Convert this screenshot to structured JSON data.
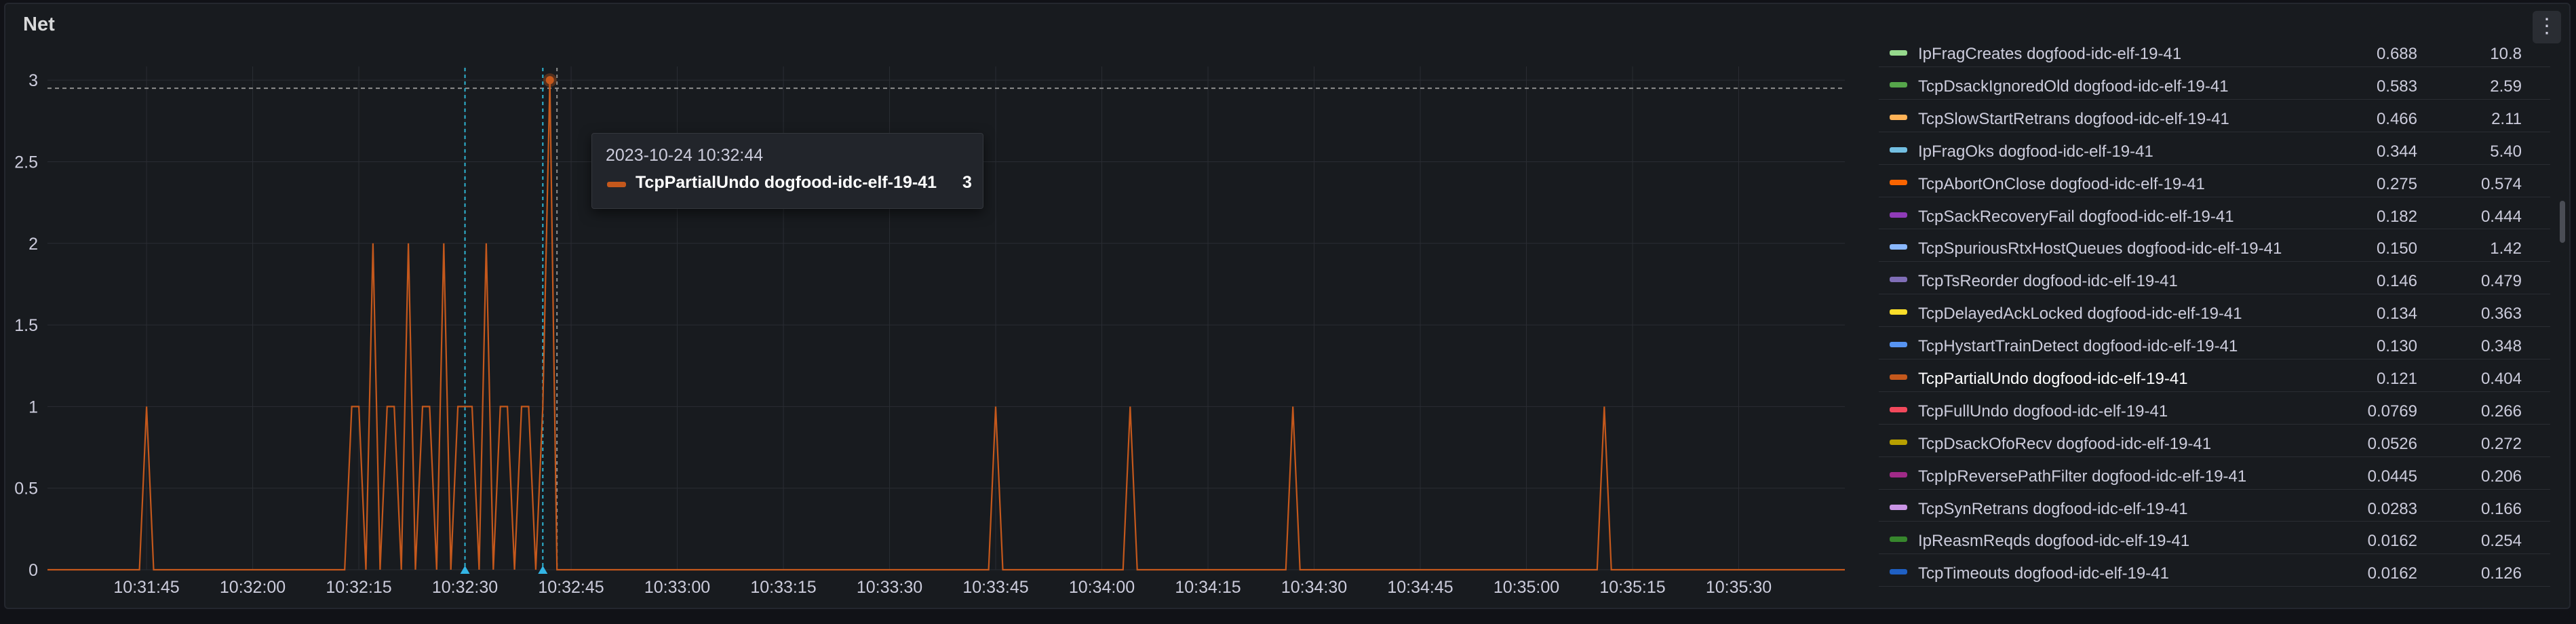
{
  "panel": {
    "title": "Net",
    "menu_icon": "kebab-menu-icon"
  },
  "tooltip": {
    "time": "2023-10-24 10:32:44",
    "series": "TcpPartialUndo dogfood-idc-elf-19-41",
    "value": "3",
    "color": "#c4581c"
  },
  "chart_data": {
    "type": "line",
    "title": "Net",
    "x_ticks": [
      "10:31:45",
      "10:32:00",
      "10:32:15",
      "10:32:30",
      "10:32:45",
      "10:33:00",
      "10:33:15",
      "10:33:30",
      "10:33:45",
      "10:34:00",
      "10:34:15",
      "10:34:30",
      "10:34:45",
      "10:35:00",
      "10:35:15",
      "10:35:30"
    ],
    "y_ticks": [
      "0",
      "0.5",
      "1",
      "1.5",
      "2",
      "2.5",
      "3"
    ],
    "ylim": [
      0,
      3.2
    ],
    "xlim": [
      "10:31:31",
      "10:35:45"
    ],
    "grid": true,
    "threshold_line": 2.95,
    "markers": [
      "10:32:30",
      "10:32:41",
      "10:32:43"
    ],
    "series": [
      {
        "name": "TcpPartialUndo dogfood-idc-elf-19-41",
        "color": "#c4581c",
        "x": [
          "10:31:31",
          "10:31:44",
          "10:31:45",
          "10:31:46",
          "10:32:13",
          "10:32:14",
          "10:32:15",
          "10:32:16",
          "10:32:17",
          "10:32:18",
          "10:32:19",
          "10:32:20",
          "10:32:21",
          "10:32:22",
          "10:32:23",
          "10:32:24",
          "10:32:25",
          "10:32:26",
          "10:32:27",
          "10:32:28",
          "10:32:29",
          "10:32:30",
          "10:32:31",
          "10:32:32",
          "10:32:33",
          "10:32:34",
          "10:32:35",
          "10:32:36",
          "10:32:37",
          "10:32:38",
          "10:32:39",
          "10:32:40",
          "10:32:41",
          "10:32:42",
          "10:32:43",
          "10:32:44",
          "10:32:45",
          "10:32:46",
          "10:33:44",
          "10:33:45",
          "10:33:46",
          "10:34:03",
          "10:34:04",
          "10:34:05",
          "10:34:26",
          "10:34:27",
          "10:34:28",
          "10:35:10",
          "10:35:11",
          "10:35:12",
          "10:35:45"
        ],
        "y": [
          0,
          0,
          1,
          0,
          0,
          1,
          1,
          0,
          2,
          0,
          1,
          1,
          0,
          2,
          0,
          1,
          1,
          0,
          2,
          0,
          1,
          1,
          1,
          0,
          2,
          0,
          1,
          1,
          0,
          1,
          1,
          0,
          1,
          3,
          0,
          0,
          0,
          0,
          0,
          1,
          0,
          0,
          1,
          0,
          0,
          1,
          0,
          0,
          1,
          0,
          0
        ]
      }
    ]
  },
  "legend": [
    {
      "name": "IpFragCreates dogfood-idc-elf-19-41",
      "mean": "0.688",
      "max": "10.8",
      "color": "#96d98d"
    },
    {
      "name": "TcpDsackIgnoredOld dogfood-idc-elf-19-41",
      "mean": "0.583",
      "max": "2.59",
      "color": "#56a64b"
    },
    {
      "name": "TcpSlowStartRetrans dogfood-idc-elf-19-41",
      "mean": "0.466",
      "max": "2.11",
      "color": "#ffb357"
    },
    {
      "name": "IpFragOks dogfood-idc-elf-19-41",
      "mean": "0.344",
      "max": "5.40",
      "color": "#73bfe2"
    },
    {
      "name": "TcpAbortOnClose dogfood-idc-elf-19-41",
      "mean": "0.275",
      "max": "0.574",
      "color": "#fa6400"
    },
    {
      "name": "TcpSackRecoveryFail dogfood-idc-elf-19-41",
      "mean": "0.182",
      "max": "0.444",
      "color": "#8f3bb8"
    },
    {
      "name": "TcpSpuriousRtxHostQueues dogfood-idc-elf-19-41",
      "mean": "0.150",
      "max": "1.42",
      "color": "#8ab8ff"
    },
    {
      "name": "TcpTsReorder dogfood-idc-elf-19-41",
      "mean": "0.146",
      "max": "0.479",
      "color": "#806eb7"
    },
    {
      "name": "TcpDelayedAckLocked dogfood-idc-elf-19-41",
      "mean": "0.134",
      "max": "0.363",
      "color": "#fade2a"
    },
    {
      "name": "TcpHystartTrainDetect dogfood-idc-elf-19-41",
      "mean": "0.130",
      "max": "0.348",
      "color": "#5794f2"
    },
    {
      "name": "TcpPartialUndo dogfood-idc-elf-19-41",
      "mean": "0.121",
      "max": "0.404",
      "color": "#c4581c",
      "active": true
    },
    {
      "name": "TcpFullUndo dogfood-idc-elf-19-41",
      "mean": "0.0769",
      "max": "0.266",
      "color": "#f2495c"
    },
    {
      "name": "TcpDsackOfoRecv dogfood-idc-elf-19-41",
      "mean": "0.0526",
      "max": "0.272",
      "color": "#b8a000"
    },
    {
      "name": "TcpIpReversePathFilter dogfood-idc-elf-19-41",
      "mean": "0.0445",
      "max": "0.206",
      "color": "#a02a88"
    },
    {
      "name": "TcpSynRetrans dogfood-idc-elf-19-41",
      "mean": "0.0283",
      "max": "0.166",
      "color": "#ca95e5"
    },
    {
      "name": "IpReasmReqds dogfood-idc-elf-19-41",
      "mean": "0.0162",
      "max": "0.254",
      "color": "#37872d"
    },
    {
      "name": "TcpTimeouts dogfood-idc-elf-19-41",
      "mean": "0.0162",
      "max": "0.126",
      "color": "#1f60c4"
    }
  ]
}
